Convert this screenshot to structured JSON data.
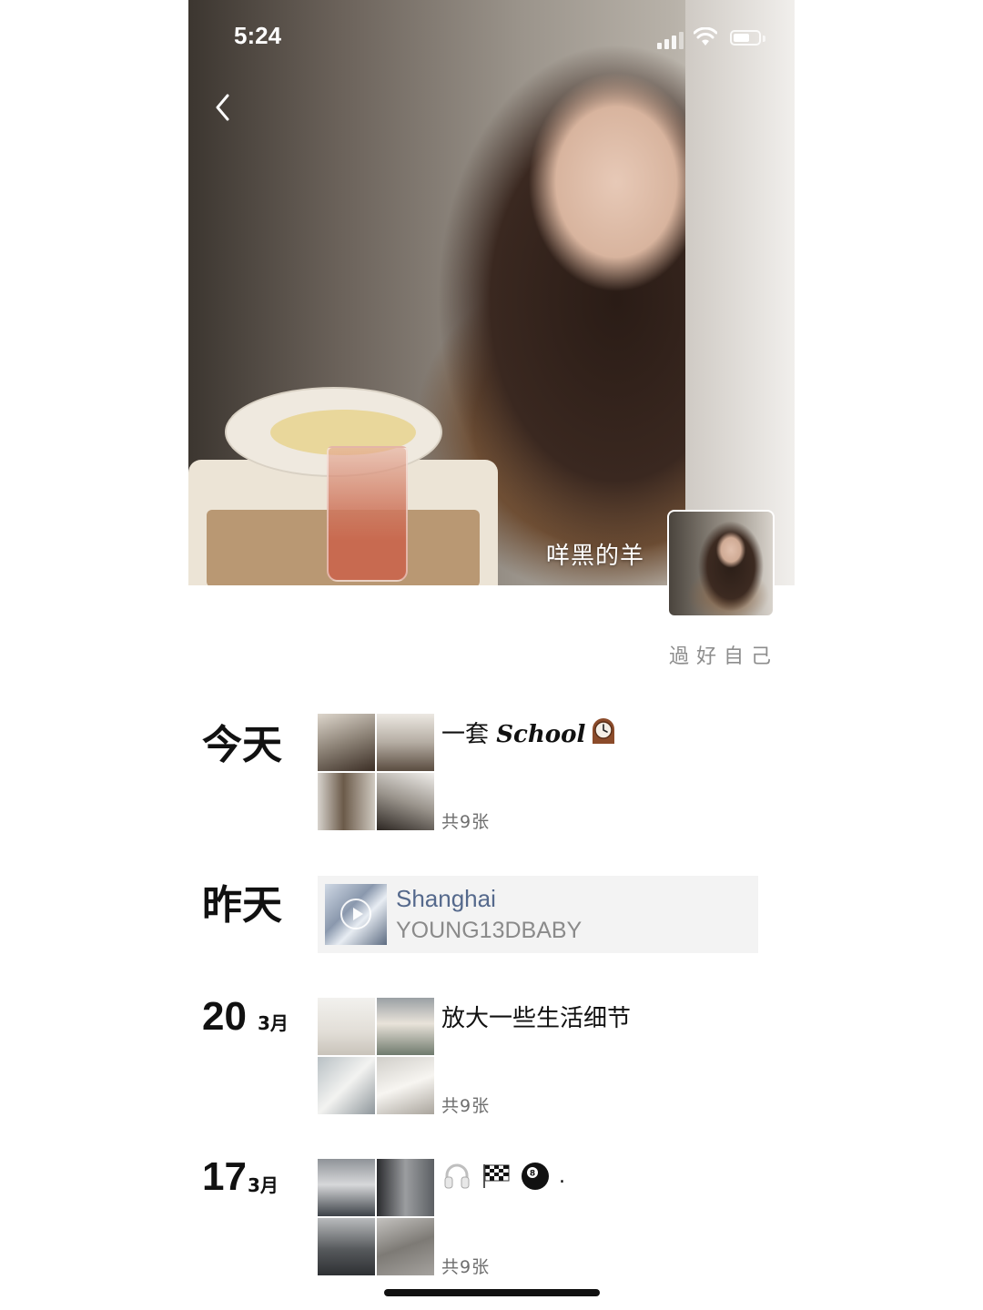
{
  "status_bar": {
    "time": "5:24"
  },
  "profile": {
    "name": "咩黑的羊",
    "signature": "過好自己"
  },
  "timeline": [
    {
      "day": "今天",
      "title_prefix": "一套 ",
      "title_word": "School",
      "title_emoji": "clock-icon",
      "count": "共9张"
    },
    {
      "day": "昨天",
      "music": {
        "title": "Shanghai",
        "artist": "YOUNG13DBABY"
      }
    },
    {
      "day_num": "20",
      "month": "3月",
      "title": "放大一些生活细节",
      "count": "共9张"
    },
    {
      "day_num": "17",
      "month": "3月",
      "title_icons": [
        "headphones-icon",
        "checkered-flag-icon",
        "8-ball-icon"
      ],
      "title_suffix": ".",
      "count": "共9张"
    }
  ],
  "colors": {
    "link_blue": "#55698c",
    "muted_gray": "#8d8d8d",
    "card_bg": "#f3f3f3"
  }
}
